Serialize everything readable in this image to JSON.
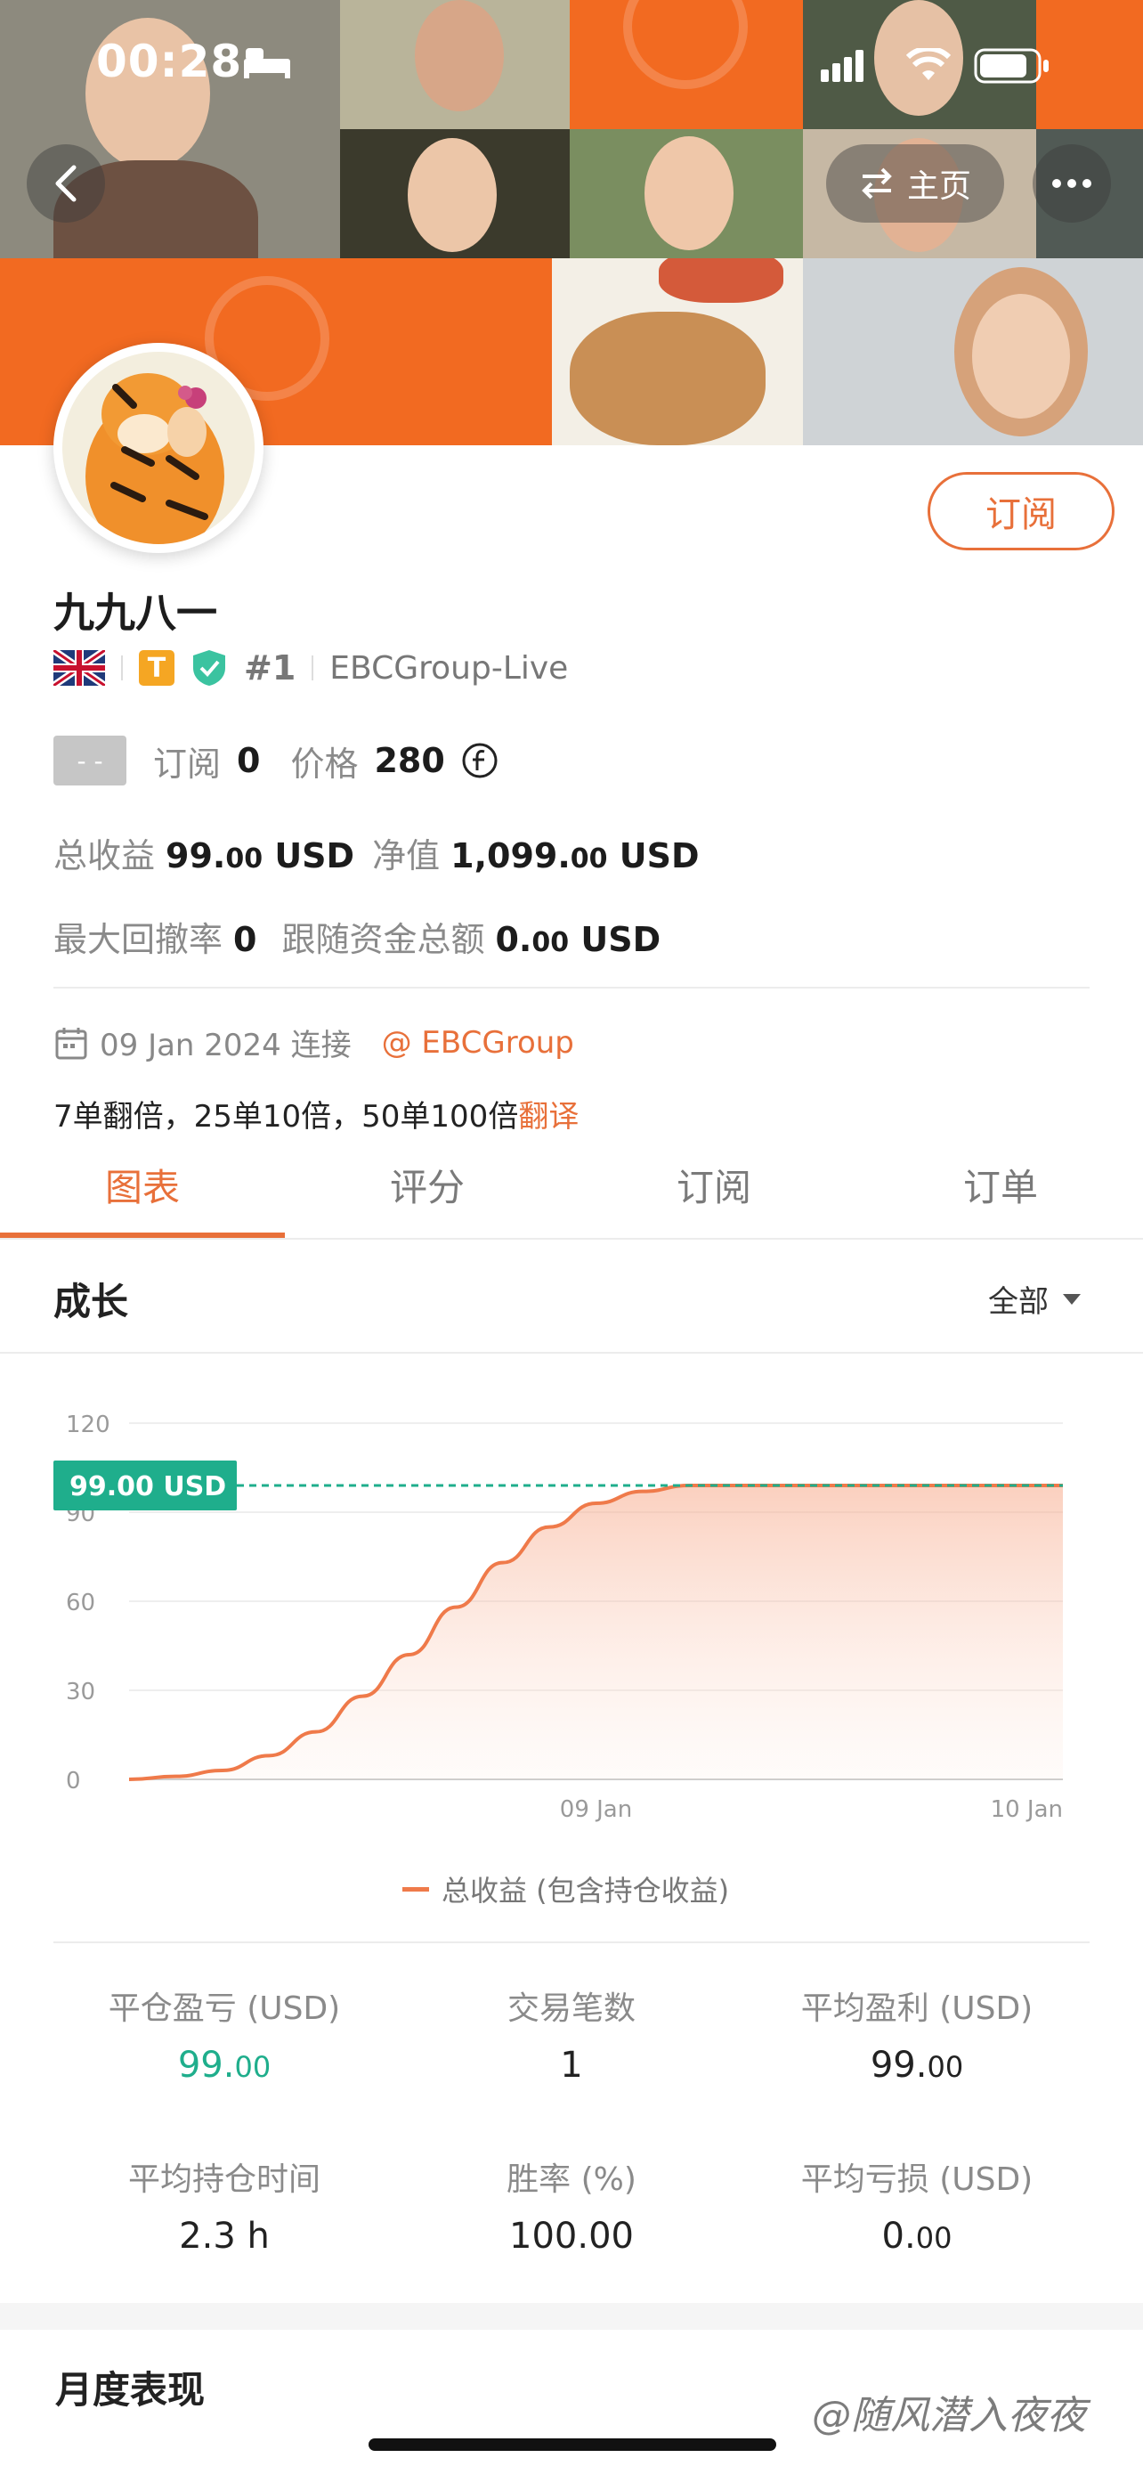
{
  "status_bar": {
    "time": "00:28"
  },
  "header": {
    "home_label": "主页"
  },
  "profile": {
    "name": "九九八一",
    "badge_letter": "T",
    "rank": "#1",
    "server": "EBCGroup-Live",
    "subscribe_button": "订阅",
    "status_chip": "- -",
    "subscriptions_label": "订阅",
    "subscriptions_value": "0",
    "price_label": "价格",
    "price_value": "280",
    "total_profit_label": "总收益",
    "total_profit_int": "99.",
    "total_profit_dec": "00",
    "total_profit_unit": "USD",
    "net_value_label": "净值",
    "net_value_int": "1,099.",
    "net_value_dec": "00",
    "net_value_unit": "USD",
    "max_drawdown_label": "最大回撤率",
    "max_drawdown_value": "0",
    "follow_funds_label": "跟随资金总额",
    "follow_funds_int": "0.",
    "follow_funds_dec": "00",
    "follow_funds_unit": "USD",
    "connect_date": "09 Jan 2024 连接",
    "broker_link": "@ EBCGroup",
    "bio": "7单翻倍，25单10倍，50单100倍",
    "translate_link": "翻译"
  },
  "tabs": [
    "图表",
    "评分",
    "订阅",
    "订单"
  ],
  "growth": {
    "title": "成长",
    "filter": "全部"
  },
  "colors": {
    "accent": "#e8703a",
    "teal": "#1fae8c",
    "banner": "#f26a21"
  },
  "chart_data": {
    "type": "area",
    "ylim": [
      0,
      120
    ],
    "yticks": [
      "120",
      "90",
      "60",
      "30",
      "0"
    ],
    "x_labels": [
      "09 Jan",
      "10 Jan"
    ],
    "series": [
      {
        "name": "总收益 (包含持仓收益)",
        "points": [
          [
            0,
            0
          ],
          [
            0.05,
            1
          ],
          [
            0.1,
            3
          ],
          [
            0.15,
            8
          ],
          [
            0.2,
            16
          ],
          [
            0.25,
            28
          ],
          [
            0.3,
            42
          ],
          [
            0.35,
            58
          ],
          [
            0.4,
            73
          ],
          [
            0.45,
            85
          ],
          [
            0.5,
            93
          ],
          [
            0.55,
            97
          ],
          [
            0.6,
            99
          ],
          [
            1.0,
            99
          ]
        ]
      }
    ],
    "marker_label": "99.00 USD",
    "marker_value": 99
  },
  "stats": [
    {
      "label": "平仓盈亏 (USD)",
      "int": "99.",
      "dec": "00",
      "teal": true
    },
    {
      "label": "交易笔数",
      "int": "1",
      "dec": ""
    },
    {
      "label": "平均盈利 (USD)",
      "int": "99.",
      "dec": "00"
    },
    {
      "label": "平均持仓时间",
      "int": "2.3 h",
      "dec": ""
    },
    {
      "label": "胜率 (%)",
      "int": "100.00",
      "dec": ""
    },
    {
      "label": "平均亏损 (USD)",
      "int": "0.",
      "dec": "00"
    }
  ],
  "monthly": {
    "title": "月度表现"
  },
  "watermark": "@随风潜入夜夜"
}
